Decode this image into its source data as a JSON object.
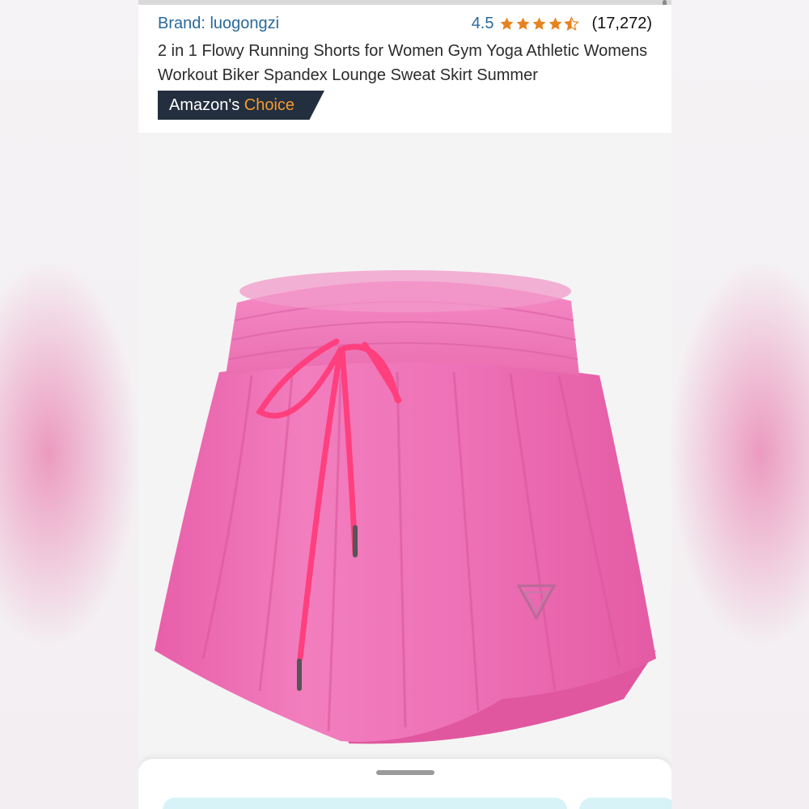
{
  "product": {
    "brand_label": "Brand: luogongzi",
    "rating_value": "4.5",
    "rating_stars": 4.5,
    "review_count": "(17,272)",
    "title": "2 in 1 Flowy Running Shorts for Women Gym Yoga Athletic Womens Workout Biker Spandex Lounge Sweat Skirt Summer",
    "badge_prefix": "Amazon's",
    "badge_highlight": "Choice"
  },
  "icons": {
    "star": "star-icon",
    "logo": "brand-logo-icon"
  },
  "colors": {
    "link_blue": "#2a6a9a",
    "star_orange": "#e7821f",
    "badge_bg": "#232f3e",
    "badge_accent": "#f79a2d",
    "product_pink": "#ee74b8",
    "drawstring": "#ff3f7e"
  }
}
